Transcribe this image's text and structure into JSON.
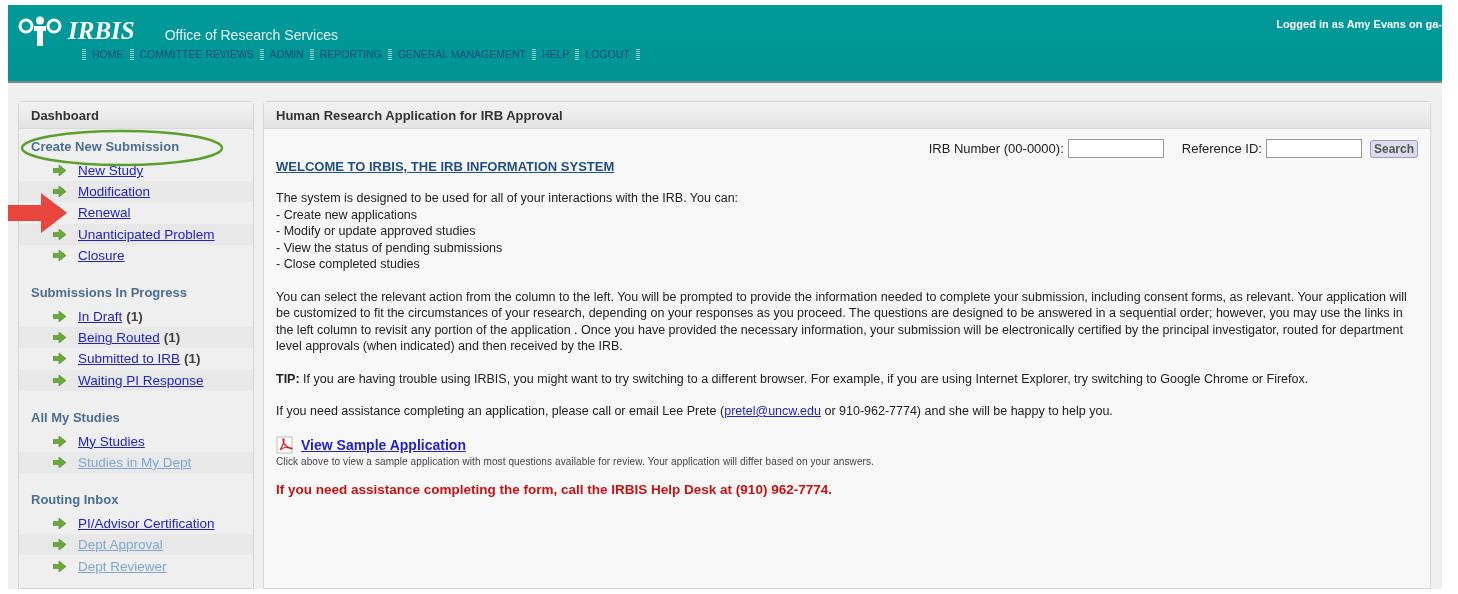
{
  "header": {
    "logo": "IRBIS",
    "subtitle": "Office of Research Services",
    "user": "Logged in as Amy Evans on ga-",
    "nav": [
      {
        "label": "HOME"
      },
      {
        "label": "COMMITTEE REVIEWS"
      },
      {
        "label": "ADMIN"
      },
      {
        "label": "REPORTING"
      },
      {
        "label": "GENERAL MANAGEMENT"
      },
      {
        "label": "HELP"
      },
      {
        "label": "LOGOUT"
      }
    ]
  },
  "sidebar": {
    "title": "Dashboard",
    "sections": [
      {
        "heading": "Create New Submission",
        "circled": true,
        "items": [
          {
            "label": "New Study",
            "disabled": false,
            "pointed": false
          },
          {
            "label": "Modification",
            "disabled": false,
            "pointed": false
          },
          {
            "label": "Renewal",
            "disabled": false,
            "pointed": true
          },
          {
            "label": "Unanticipated Problem",
            "disabled": false,
            "pointed": false
          },
          {
            "label": "Closure",
            "disabled": false,
            "pointed": false
          }
        ]
      },
      {
        "heading": "Submissions In Progress",
        "circled": false,
        "items": [
          {
            "label": "In Draft",
            "count": "(1)",
            "disabled": false,
            "pointed": false
          },
          {
            "label": "Being Routed",
            "count": "(1)",
            "disabled": false,
            "pointed": false
          },
          {
            "label": "Submitted to IRB",
            "count": "(1)",
            "disabled": false,
            "pointed": false
          },
          {
            "label": "Waiting PI Response",
            "disabled": false,
            "pointed": false
          }
        ]
      },
      {
        "heading": "All My Studies",
        "circled": false,
        "items": [
          {
            "label": "My Studies",
            "disabled": false,
            "pointed": false
          },
          {
            "label": "Studies in My Dept",
            "disabled": true,
            "pointed": false
          }
        ]
      },
      {
        "heading": "Routing Inbox",
        "circled": false,
        "items": [
          {
            "label": "PI/Advisor Certification",
            "disabled": false,
            "pointed": false
          },
          {
            "label": "Dept Approval",
            "disabled": true,
            "pointed": false
          },
          {
            "label": "Dept Reviewer",
            "disabled": true,
            "pointed": false
          }
        ]
      }
    ]
  },
  "main": {
    "title": "Human Research Application for IRB Approval",
    "search": {
      "irb_label": "IRB Number (00-0000):",
      "ref_label": "Reference ID:",
      "button": "Search"
    },
    "welcome": "WELCOME TO IRBIS, THE IRB INFORMATION SYSTEM",
    "intro": [
      "The system is designed to be used for all of your interactions with the IRB. You can:",
      "- Create new applications",
      "- Modify or update approved studies",
      "- View the status of pending submissions",
      "- Close completed studies"
    ],
    "paragraph": "You can select the relevant action from the column to the left. You will be prompted to provide the information needed to complete your submission, including consent forms, as relevant. Your application will be customized to fit the circumstances of your research, depending on your responses as you proceed. The questions are designed to be answered in a sequential order; however, you may use the links in the left column to revisit any portion of the application . Once you have provided the necessary information, your submission will be electronically certified by the principal investigator, routed for department level approvals (when indicated) and then received by the IRB.",
    "tip": "**TIP:** If you are having trouble using IRBIS, you might want to try switching to a different browser. For example, if you are using Internet Explorer, try switching to Google Chrome or Firefox.",
    "contact": {
      "before": "If you need assistance completing an application, please call or email Lee Prete (",
      "link": "pretel@uncw.edu",
      "after": " or 910-962-7774) and she will be happy to help you."
    },
    "sample": {
      "link": "View Sample Application",
      "note": "Click above to view a sample application with most questions available for review. Your application will differ based on your answers."
    },
    "alert": "If you need assistance completing the form, call the IRBIS Help Desk at (910) 962-7774."
  }
}
